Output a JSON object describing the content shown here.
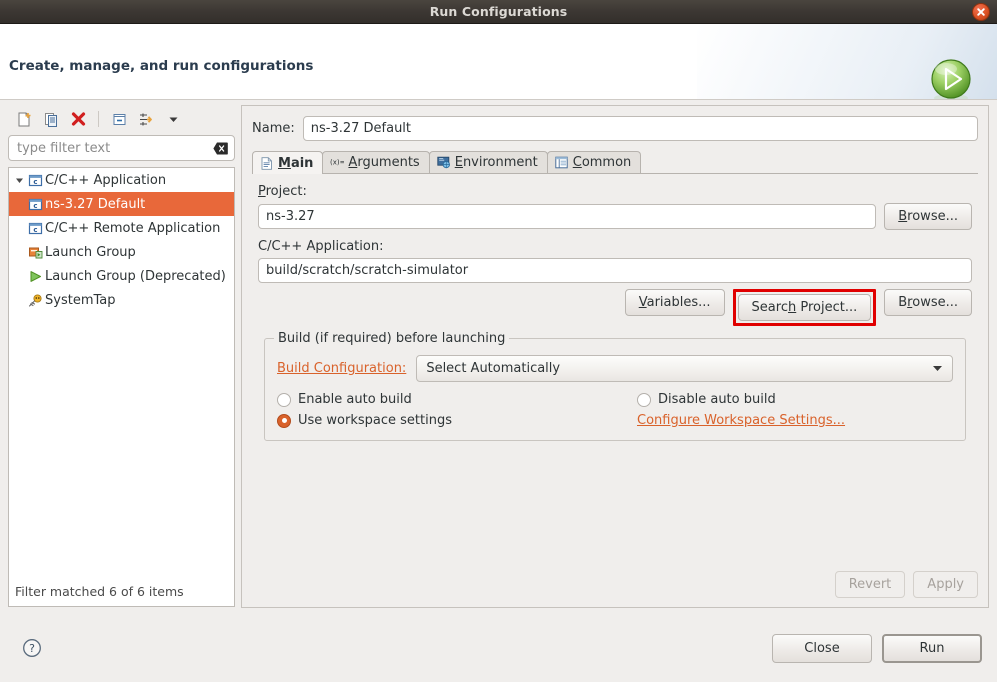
{
  "window": {
    "title": "Run Configurations",
    "close_icon": "close-icon"
  },
  "header": {
    "title": "Create, manage, and run configurations",
    "icon": "run-play-icon"
  },
  "sidebar": {
    "toolbar": [
      {
        "name": "new-launch-configuration-icon",
        "tooltip": "New launch configuration"
      },
      {
        "name": "duplicate-icon",
        "tooltip": "Duplicate"
      },
      {
        "name": "delete-icon",
        "tooltip": "Delete"
      },
      {
        "name": "collapse-all-icon",
        "tooltip": "Collapse All"
      },
      {
        "name": "filter-icon",
        "tooltip": "Filter"
      },
      {
        "name": "chevron-down-icon",
        "tooltip": "Menu"
      }
    ],
    "filter": {
      "value": "",
      "placeholder": "type filter text",
      "clear_icon": "clear-icon"
    },
    "tree": [
      {
        "label": "C/C++ Application",
        "icon": "c-application-icon",
        "expanded": true,
        "indent": 0,
        "selected": false
      },
      {
        "label": "ns-3.27 Default",
        "icon": "c-application-icon",
        "expanded": null,
        "indent": 1,
        "selected": true
      },
      {
        "label": "C/C++ Remote Application",
        "icon": "c-application-icon",
        "expanded": null,
        "indent": 0,
        "selected": false
      },
      {
        "label": "Launch Group",
        "icon": "launch-group-icon",
        "expanded": null,
        "indent": 0,
        "selected": false
      },
      {
        "label": "Launch Group (Deprecated)",
        "icon": "launch-group-deprecated-icon",
        "expanded": null,
        "indent": 0,
        "selected": false
      },
      {
        "label": "SystemTap",
        "icon": "systemtap-icon",
        "expanded": null,
        "indent": 0,
        "selected": false
      }
    ],
    "status": "Filter matched 6 of 6 items"
  },
  "main": {
    "name_label": "Name:",
    "name_value": "ns-3.27 Default",
    "tabs": [
      {
        "label": "Main",
        "icon": "main-tab-icon",
        "active": true,
        "mnemonic": "M"
      },
      {
        "label": "Arguments",
        "icon": "arguments-tab-icon",
        "active": false,
        "mnemonic": "A"
      },
      {
        "label": "Environment",
        "icon": "environment-tab-icon",
        "active": false,
        "mnemonic": "E"
      },
      {
        "label": "Common",
        "icon": "common-tab-icon",
        "active": false,
        "mnemonic": "C"
      }
    ],
    "project": {
      "label": "Project:",
      "value": "ns-3.27",
      "browse_label": "Browse..."
    },
    "application": {
      "label": "C/C++ Application:",
      "value": "build/scratch/scratch-simulator",
      "variables_label": "Variables...",
      "search_project_label": "Search Project...",
      "browse_label": "Browse...",
      "highlighted_button": "Search Project...",
      "highlight_color": "#e00000"
    },
    "build_group": {
      "title": "Build (if required) before launching",
      "build_config_link": "Build Configuration:",
      "build_config_value": "Select Automatically",
      "dropdown_icon": "chevron-down-icon",
      "options": [
        {
          "label": "Enable auto build",
          "checked": false
        },
        {
          "label": "Disable auto build",
          "checked": false
        },
        {
          "label": "Use workspace settings",
          "checked": true
        }
      ],
      "configure_link": "Configure Workspace Settings..."
    },
    "revert_label": "Revert",
    "apply_label": "Apply",
    "revert_enabled": false,
    "apply_enabled": false
  },
  "footer": {
    "help_icon": "help-icon",
    "close_label": "Close",
    "run_label": "Run"
  },
  "colors": {
    "accent_orange": "#d9622b",
    "selection_orange": "#e8683a",
    "highlight_red": "#e00000",
    "titlebar": "#3c3733",
    "panel_bg": "#f0eeec"
  }
}
